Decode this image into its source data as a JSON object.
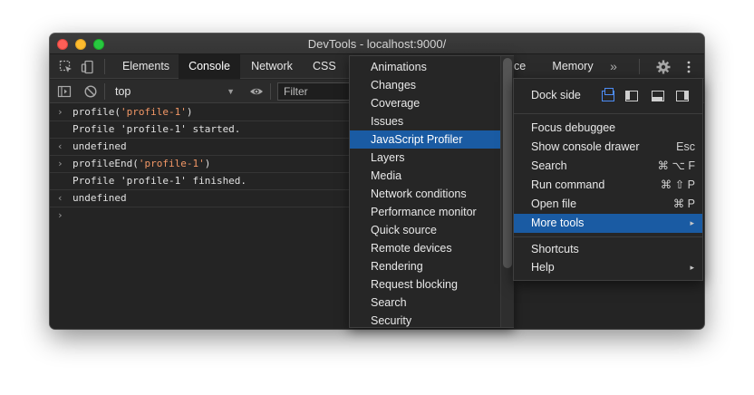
{
  "window": {
    "title": "DevTools - localhost:9000/"
  },
  "tabs": {
    "elements": "Elements",
    "console": "Console",
    "network": "Network",
    "css_overview": "CSS Ov",
    "performance_partial": "nce",
    "memory": "Memory",
    "more": "»"
  },
  "toolbar": {
    "context": "top",
    "filter_placeholder": "Filter"
  },
  "console": {
    "lines": [
      {
        "gutter": "›",
        "parts": [
          "profile(",
          "'profile-1'",
          ")"
        ]
      },
      {
        "gutter": "",
        "text": "Profile 'profile-1' started."
      },
      {
        "gutter": "‹",
        "text": "undefined"
      },
      {
        "gutter": "›",
        "parts": [
          "profileEnd(",
          "'profile-1'",
          ")"
        ]
      },
      {
        "gutter": "",
        "text": "Profile 'profile-1' finished."
      },
      {
        "gutter": "‹",
        "text": "undefined"
      }
    ],
    "prompt": "›"
  },
  "more_tools_menu": {
    "items": [
      "Animations",
      "Changes",
      "Coverage",
      "Issues",
      "JavaScript Profiler",
      "Layers",
      "Media",
      "Network conditions",
      "Performance monitor",
      "Quick source",
      "Remote devices",
      "Rendering",
      "Request blocking",
      "Search",
      "Security"
    ],
    "highlighted_index": 4
  },
  "main_menu": {
    "dock_side_label": "Dock side",
    "items": [
      {
        "label": "Focus debuggee",
        "shortcut": ""
      },
      {
        "label": "Show console drawer",
        "shortcut": "Esc"
      },
      {
        "label": "Search",
        "shortcut": "⌘ ⌥ F"
      },
      {
        "label": "Run command",
        "shortcut": "⌘ ⇧ P"
      },
      {
        "label": "Open file",
        "shortcut": "⌘ P"
      },
      {
        "label": "More tools",
        "shortcut": "▸"
      }
    ],
    "items2": [
      {
        "label": "Shortcuts",
        "shortcut": ""
      },
      {
        "label": "Help",
        "shortcut": "▸"
      }
    ]
  },
  "colors": {
    "highlight": "#1a5ba3",
    "string": "#f29766",
    "prompt": "#4d8df7"
  }
}
